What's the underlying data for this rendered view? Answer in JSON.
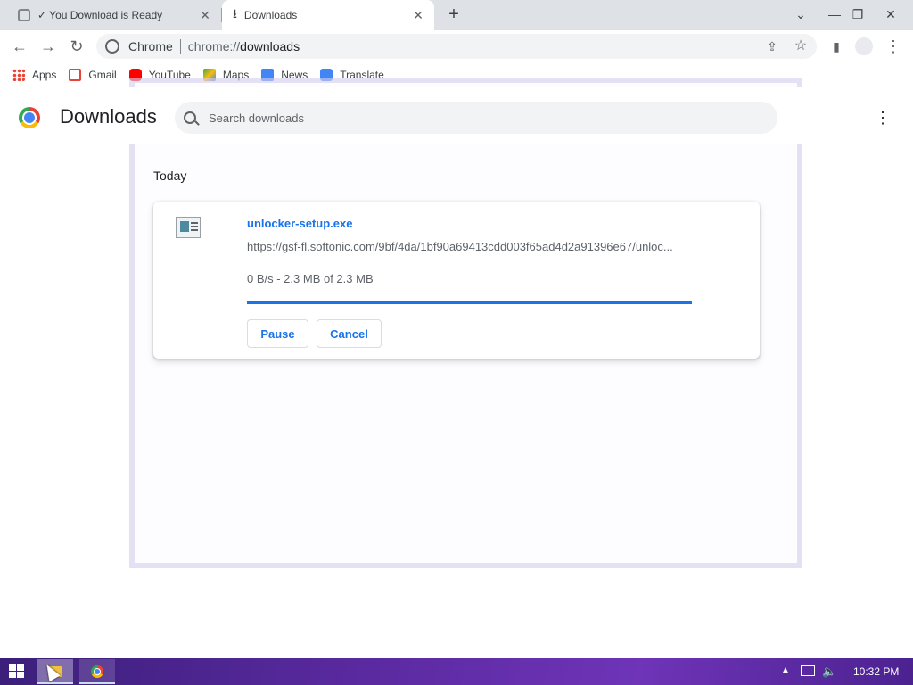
{
  "tabs": [
    {
      "title": "✓ You Download is Ready",
      "active": false
    },
    {
      "title": "Downloads",
      "active": true
    }
  ],
  "toolbar": {
    "site_label": "Chrome",
    "url_scheme": "chrome://",
    "url_host": "downloads"
  },
  "bookmarks": [
    {
      "label": "Apps",
      "icon": "apps-grid-icon"
    },
    {
      "label": "Gmail",
      "icon": "gmail-icon"
    },
    {
      "label": "YouTube",
      "icon": "youtube-icon"
    },
    {
      "label": "Maps",
      "icon": "maps-icon"
    },
    {
      "label": "News",
      "icon": "news-icon"
    },
    {
      "label": "Translate",
      "icon": "translate-icon"
    }
  ],
  "page": {
    "title": "Downloads",
    "search_placeholder": "Search downloads",
    "date_group": "Today"
  },
  "download": {
    "file_name": "unlocker-setup.exe",
    "url": "https://gsf-fl.softonic.com/9bf/4da/1bf90a69413cdd003f65ad4d2a91396e67/unloc...",
    "status": "0 B/s - 2.3 MB of 2.3 MB",
    "progress": 1.0,
    "pause_label": "Pause",
    "cancel_label": "Cancel"
  },
  "taskbar": {
    "clock": "10:32 PM"
  },
  "colors": {
    "accent": "#1a73e8",
    "taskbar": "#5a2aa0"
  }
}
